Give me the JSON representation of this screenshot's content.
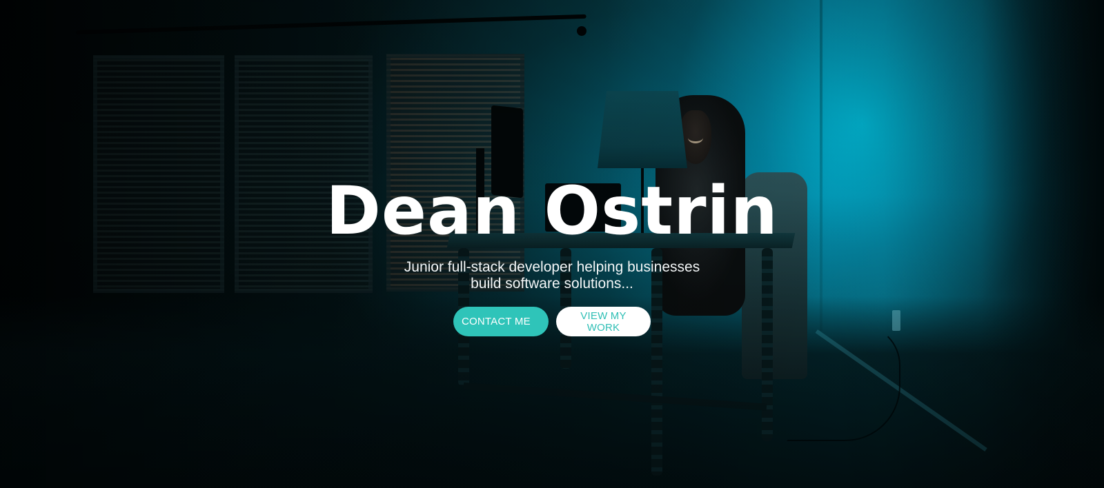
{
  "hero": {
    "title": "Dean Ostrin",
    "subtitle": "Junior full-stack developer helping businesses build software solutions...",
    "background": "dark-room-hooded-person-at-desk-teal-lighting"
  },
  "actions": {
    "contact_label": "CONTACT ME",
    "work_label": "VIEW MY WORK"
  },
  "colors": {
    "accent": "#2fc4b9",
    "button_text_light": "#ffffff",
    "secondary_button_bg": "#ffffff",
    "title_text": "#ffffff",
    "background_dark": "#020b0d",
    "background_teal": "#0c8aa2"
  }
}
